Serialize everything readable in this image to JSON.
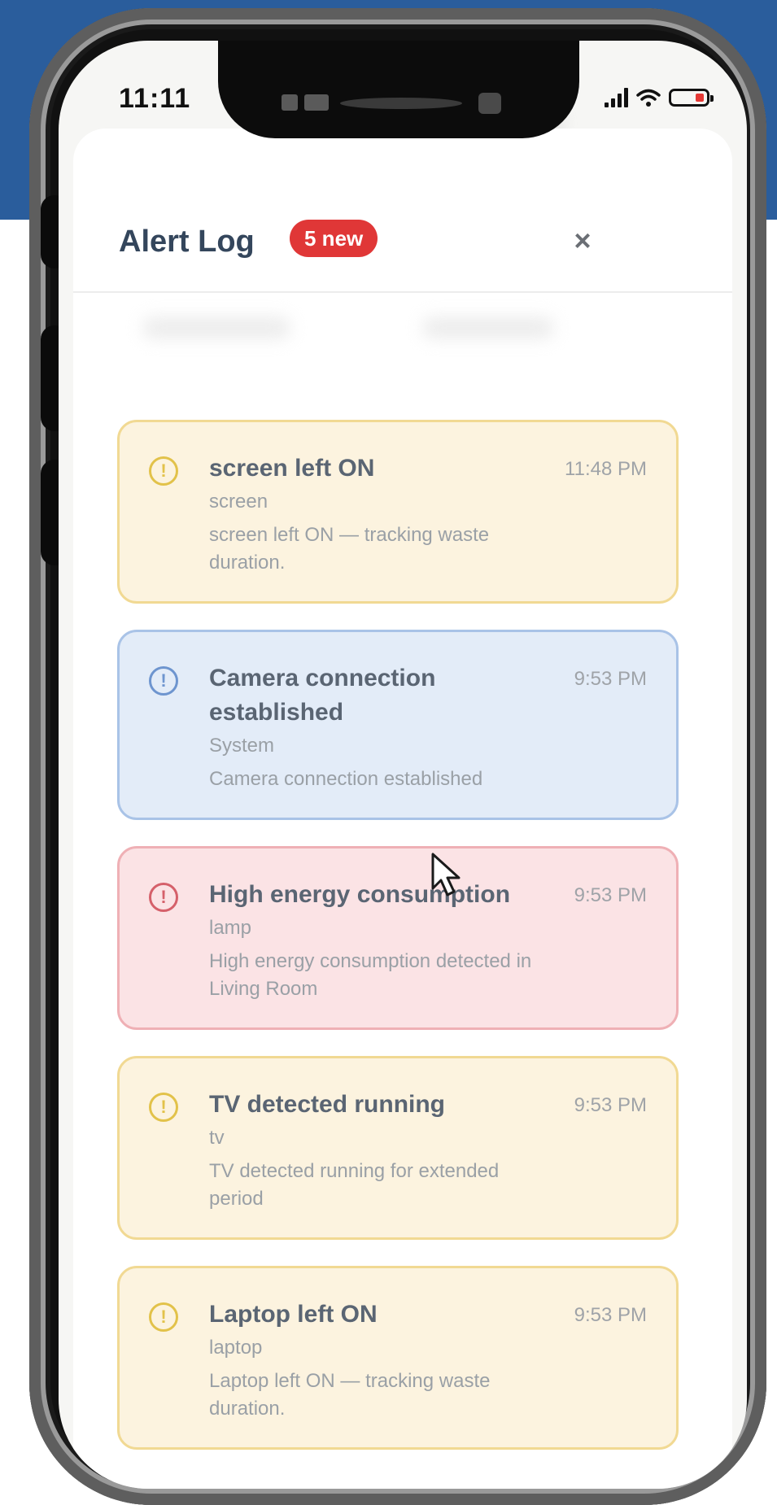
{
  "status_bar": {
    "time": "11:11"
  },
  "panel": {
    "title": "Alert Log",
    "badge": "5 new",
    "close_label": "×"
  },
  "alerts": [
    {
      "severity": "warning",
      "icon": "alert-circle-icon",
      "title": "screen left ON",
      "source": "screen",
      "message": "screen left ON — tracking waste duration.",
      "time": "11:48 PM"
    },
    {
      "severity": "info",
      "icon": "alert-circle-icon",
      "title": "Camera connection established",
      "source": "System",
      "message": "Camera connection established",
      "time": "9:53 PM"
    },
    {
      "severity": "error",
      "icon": "alert-circle-icon",
      "title": "High energy consumption",
      "source": "lamp",
      "message": "High energy consumption detected in Living Room",
      "time": "9:53 PM"
    },
    {
      "severity": "warning",
      "icon": "alert-circle-icon",
      "title": "TV detected running",
      "source": "tv",
      "message": "TV detected running for extended period",
      "time": "9:53 PM"
    },
    {
      "severity": "warning",
      "icon": "alert-circle-icon",
      "title": "Laptop left ON",
      "source": "laptop",
      "message": "Laptop left ON — tracking waste duration.",
      "time": "9:53 PM"
    }
  ],
  "colors": {
    "background_top": "#2a5d9c",
    "badge": "#e03737",
    "warning_bg": "#fcf3df",
    "info_bg": "#e3ecf8",
    "error_bg": "#fbe3e5"
  }
}
